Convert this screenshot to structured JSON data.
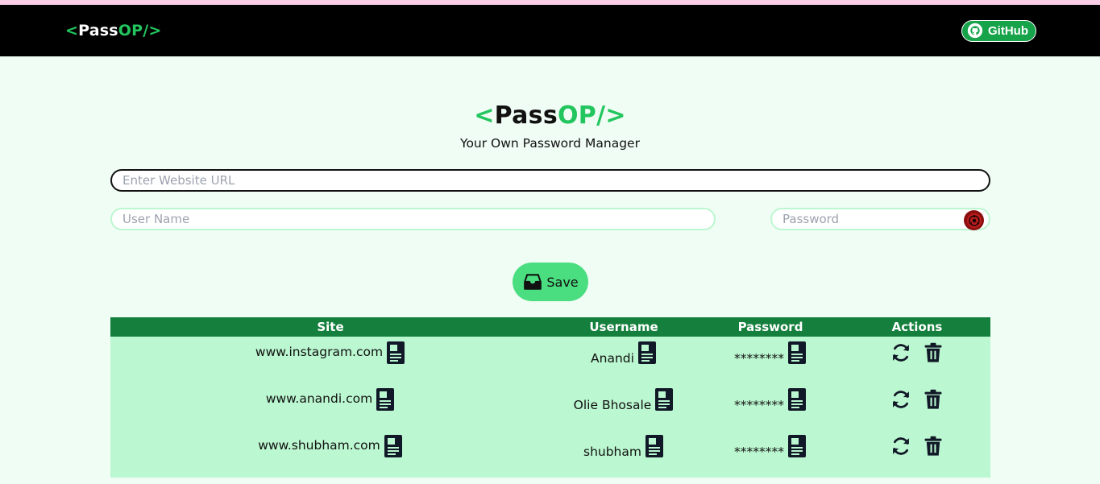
{
  "nav": {
    "logo_open": "<",
    "logo_pass": "Pass",
    "logo_op": "OP/>",
    "github_label": "GitHub"
  },
  "hero": {
    "brand_open": "<",
    "brand_pass": "Pass",
    "brand_op": "OP/>",
    "tagline": "Your Own Password Manager"
  },
  "form": {
    "url_placeholder": "Enter Website URL",
    "url_value": "",
    "username_placeholder": "User Name",
    "username_value": "",
    "password_placeholder": "Password",
    "password_value": "",
    "save_label": "Save"
  },
  "table": {
    "headers": [
      "Site",
      "Username",
      "Password",
      "Actions"
    ],
    "rows": [
      {
        "site": "www.instagram.com",
        "username": "Anandi",
        "password": "********"
      },
      {
        "site": "www.anandi.com",
        "username": "Olie Bhosale",
        "password": "********"
      },
      {
        "site": "www.shubham.com",
        "username": "shubham",
        "password": "********"
      }
    ]
  },
  "icons": {
    "github": "github-icon",
    "eye": "eye-icon",
    "save": "inbox-icon",
    "copy": "copy-icon",
    "edit": "refresh-icon",
    "delete": "trash-icon"
  },
  "colors": {
    "accent": "#22c55e",
    "nav_bg": "#000000",
    "page_bg": "#f0fdf4",
    "table_header": "#15803d",
    "table_body": "#bbf7d0",
    "save_button": "#4ade80"
  }
}
